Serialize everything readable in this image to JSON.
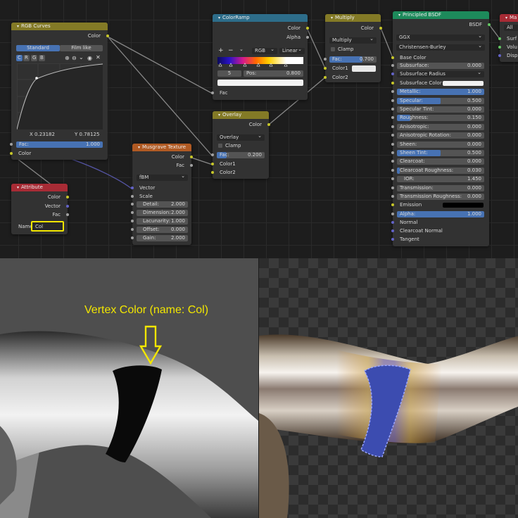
{
  "colors": {
    "socket_color": "#c7c729",
    "socket_vector": "#6363c7",
    "socket_float": "#a1a1a1",
    "socket_shader": "#63c763",
    "field_blue": "#4772b3",
    "annotation": "#f2e600"
  },
  "nodes": {
    "rgb_curves": {
      "title": "RGB Curves",
      "out_color": "Color",
      "tab_standard": "Standard",
      "tab_filmlike": "Film like",
      "channels": [
        "C",
        "R",
        "G",
        "B"
      ],
      "x_readout": "X 0.23182",
      "y_readout": "Y 0.78125",
      "fac_label": "Fac:",
      "fac_value": "1.000",
      "in_color": "Color"
    },
    "attribute": {
      "title": "Attribute",
      "outputs": [
        "Color",
        "Vector",
        "Fac"
      ],
      "name_label": "Name",
      "name_value": "Col"
    },
    "musgrave": {
      "title": "Musgrave Texture",
      "outputs": [
        "Color",
        "Fac"
      ],
      "type": "fBM",
      "in_vector": "Vector",
      "in_scale": "Scale",
      "fields": [
        {
          "label": "Detail:",
          "value": "2.000"
        },
        {
          "label": "Dimension:",
          "value": "2.000"
        },
        {
          "label": "Lacunarity:",
          "value": "1.000"
        },
        {
          "label": "Offset:",
          "value": "0.000"
        },
        {
          "label": "Gain:",
          "value": "2.000"
        }
      ]
    },
    "colorramp": {
      "title": "ColorRamp",
      "outputs": [
        "Color",
        "Alpha"
      ],
      "mode": "RGB",
      "interp": "Linear",
      "index": "5",
      "pos_label": "Pos:",
      "pos_value": "0.800",
      "in_fac": "Fac"
    },
    "overlay": {
      "title": "Overlay",
      "out_color": "Color",
      "blend": "Overlay",
      "clamp": "Clamp",
      "fac_label": "Fac:",
      "fac_value": "0.200",
      "color1": "Color1",
      "color2": "Color2"
    },
    "multiply": {
      "title": "Multiply",
      "out_color": "Color",
      "blend": "Multiply",
      "clamp": "Clamp",
      "fac_label": "Fac:",
      "fac_value": "0.700",
      "color1": "Color1",
      "color2": "Color2"
    },
    "principled": {
      "title": "Principled BSDF",
      "out": "BSDF",
      "distribution": "GGX",
      "subsurface_method": "Christensen-Burley",
      "base_color": "Base Color",
      "fields": [
        {
          "label": "Subsurface:",
          "value": "0.000",
          "fill": 0
        },
        {
          "label": "Subsurface Radius",
          "value": "",
          "fill": 0,
          "dropdown": true
        },
        {
          "label": "Subsurface Color",
          "value": "",
          "fill": 0,
          "swatch": true
        },
        {
          "label": "Metallic:",
          "value": "1.000",
          "fill": 1
        },
        {
          "label": "Specular:",
          "value": "0.500",
          "fill": 0.5
        },
        {
          "label": "Specular Tint:",
          "value": "0.000",
          "fill": 0
        },
        {
          "label": "Roughness:",
          "value": "0.150",
          "fill": 0.15
        },
        {
          "label": "Anisotropic:",
          "value": "0.000",
          "fill": 0
        },
        {
          "label": "Anisotropic Rotation:",
          "value": "0.000",
          "fill": 0
        },
        {
          "label": "Sheen:",
          "value": "0.000",
          "fill": 0
        },
        {
          "label": "Sheen Tint:",
          "value": "0.500",
          "fill": 0.5
        },
        {
          "label": "Clearcoat:",
          "value": "0.000",
          "fill": 0
        },
        {
          "label": "Clearcoat Roughness:",
          "value": "0.030",
          "fill": 0.03
        },
        {
          "label": "IOR:",
          "value": "1.450",
          "fill": 0
        },
        {
          "label": "Transmission:",
          "value": "0.000",
          "fill": 0
        },
        {
          "label": "Transmission Roughness:",
          "value": "0.000",
          "fill": 0
        },
        {
          "label": "Emission",
          "value": "",
          "fill": 0,
          "swatch_dark": true
        },
        {
          "label": "Alpha:",
          "value": "1.000",
          "fill": 1
        }
      ],
      "inputs_tail": [
        "Normal",
        "Clearcoat Normal",
        "Tangent"
      ]
    },
    "material_output": {
      "title": "Ma",
      "target": "All",
      "inputs": [
        "Surf",
        "Volu",
        "Disp"
      ]
    }
  },
  "annotation": {
    "text": "Vertex Color (name: Col)"
  }
}
